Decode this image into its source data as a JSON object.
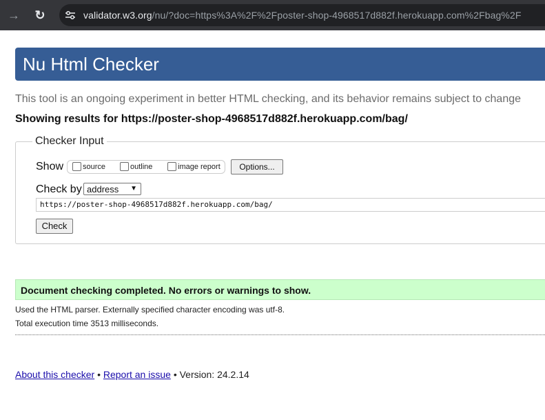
{
  "browser": {
    "url_domain": "validator.w3.org",
    "url_rest": "/nu/?doc=https%3A%2F%2Fposter-shop-4968517d882f.herokuapp.com%2Fbag%2F"
  },
  "header": {
    "title": "Nu Html Checker"
  },
  "intro": "This tool is an ongoing experiment in better HTML checking, and its behavior remains subject to change",
  "showing_results": "Showing results for https://poster-shop-4968517d882f.herokuapp.com/bag/",
  "checker_input": {
    "legend": "Checker Input",
    "show_label": "Show",
    "show_options": [
      {
        "label": "source",
        "checked": false
      },
      {
        "label": "outline",
        "checked": false
      },
      {
        "label": "image report",
        "checked": false
      }
    ],
    "options_button": "Options...",
    "check_by_label": "Check by",
    "check_by_value": "address",
    "url_value": "https://poster-shop-4968517d882f.herokuapp.com/bag/",
    "check_button": "Check"
  },
  "result": {
    "message": "Document checking completed. No errors or warnings to show.",
    "parser_info": "Used the HTML parser. Externally specified character encoding was utf-8.",
    "execution_time": "Total execution time 3513 milliseconds."
  },
  "footer": {
    "about_link": "About this checker",
    "separator": "•",
    "report_link": "Report an issue",
    "version": "Version: 24.2.14"
  },
  "colors": {
    "header_bg": "#365d95",
    "success_bg": "#ccffcc",
    "link": "#1a0dab"
  }
}
